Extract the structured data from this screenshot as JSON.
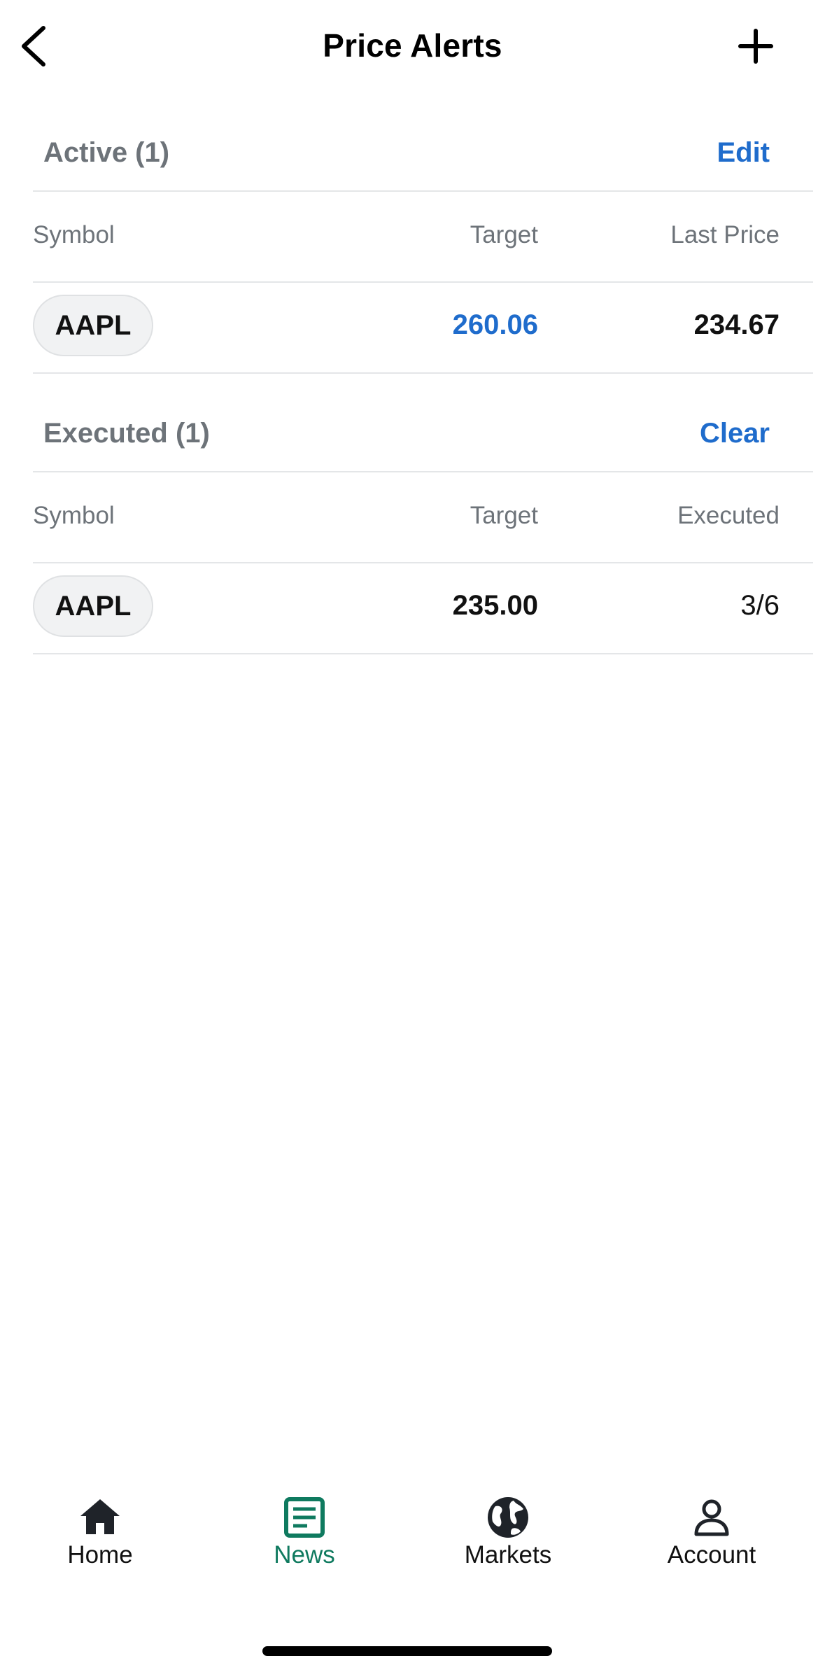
{
  "header": {
    "title": "Price Alerts",
    "back_icon": "chevron-left-icon",
    "add_icon": "plus-icon"
  },
  "active": {
    "title": "Active (1)",
    "action": "Edit",
    "columns": [
      "Symbol",
      "Target",
      "Last Price"
    ],
    "rows": [
      {
        "symbol": "AAPL",
        "target": "260.06",
        "last_price": "234.67"
      }
    ]
  },
  "executed": {
    "title": "Executed (1)",
    "action": "Clear",
    "columns": [
      "Symbol",
      "Target",
      "Executed"
    ],
    "rows": [
      {
        "symbol": "AAPL",
        "target": "235.00",
        "executed": "3/6"
      }
    ]
  },
  "nav": {
    "items": [
      {
        "label": "Home",
        "icon": "home-icon",
        "active": false
      },
      {
        "label": "News",
        "icon": "news-icon",
        "active": true
      },
      {
        "label": "Markets",
        "icon": "globe-icon",
        "active": false
      },
      {
        "label": "Account",
        "icon": "user-icon",
        "active": false
      }
    ]
  },
  "colors": {
    "accent_blue": "#1f6ccc",
    "active_green": "#0f7a5f",
    "muted_text": "#6d7379",
    "divider": "#e4e6e8"
  }
}
